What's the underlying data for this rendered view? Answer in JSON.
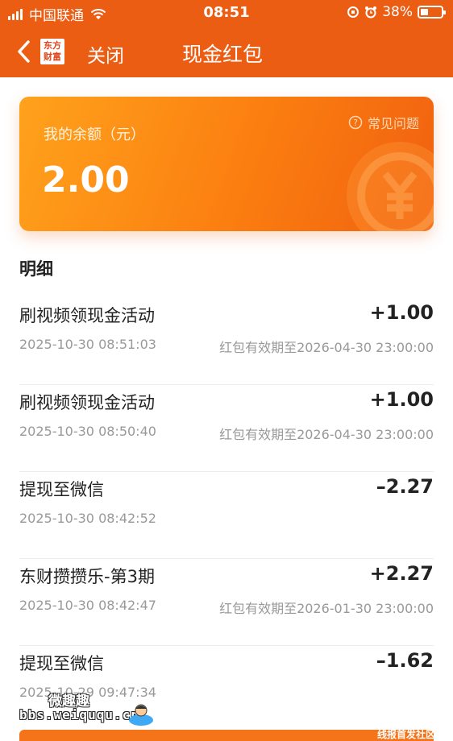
{
  "status_bar": {
    "carrier": "中国联通",
    "time": "08:51",
    "battery": "38%"
  },
  "nav": {
    "logo_text_line1": "东方",
    "logo_text_line2": "财富",
    "close_label": "关闭",
    "title": "现金红包"
  },
  "balance": {
    "label": "我的余额（元）",
    "amount": "2.00",
    "faq_label": "常见问题"
  },
  "section_title": "明细",
  "transactions": [
    {
      "title": "刷视频领现金活动",
      "amount": "+1.00",
      "time": "2025-10-30 08:51:03",
      "expiry": "红包有效期至2026-04-30 23:00:00"
    },
    {
      "title": "刷视频领现金活动",
      "amount": "+1.00",
      "time": "2025-10-30 08:50:40",
      "expiry": "红包有效期至2026-04-30 23:00:00"
    },
    {
      "title": "提现至微信",
      "amount": "–2.27",
      "time": "2025-10-30 08:42:52",
      "expiry": ""
    },
    {
      "title": "东财攒攒乐-第3期",
      "amount": "+2.27",
      "time": "2025-10-30 08:42:47",
      "expiry": "红包有效期至2026-01-30 23:00:00"
    },
    {
      "title": "提现至微信",
      "amount": "–1.62",
      "time": "2025-10-29 09:47:34",
      "expiry": ""
    }
  ],
  "watermark": {
    "top": "微趣趣",
    "bottom": "bbs.weiququ.cn"
  },
  "bottom_note": "线报首发社区",
  "colors": {
    "header": "#ec5d14",
    "card_start": "#ffa21c",
    "card_end": "#f06010"
  }
}
